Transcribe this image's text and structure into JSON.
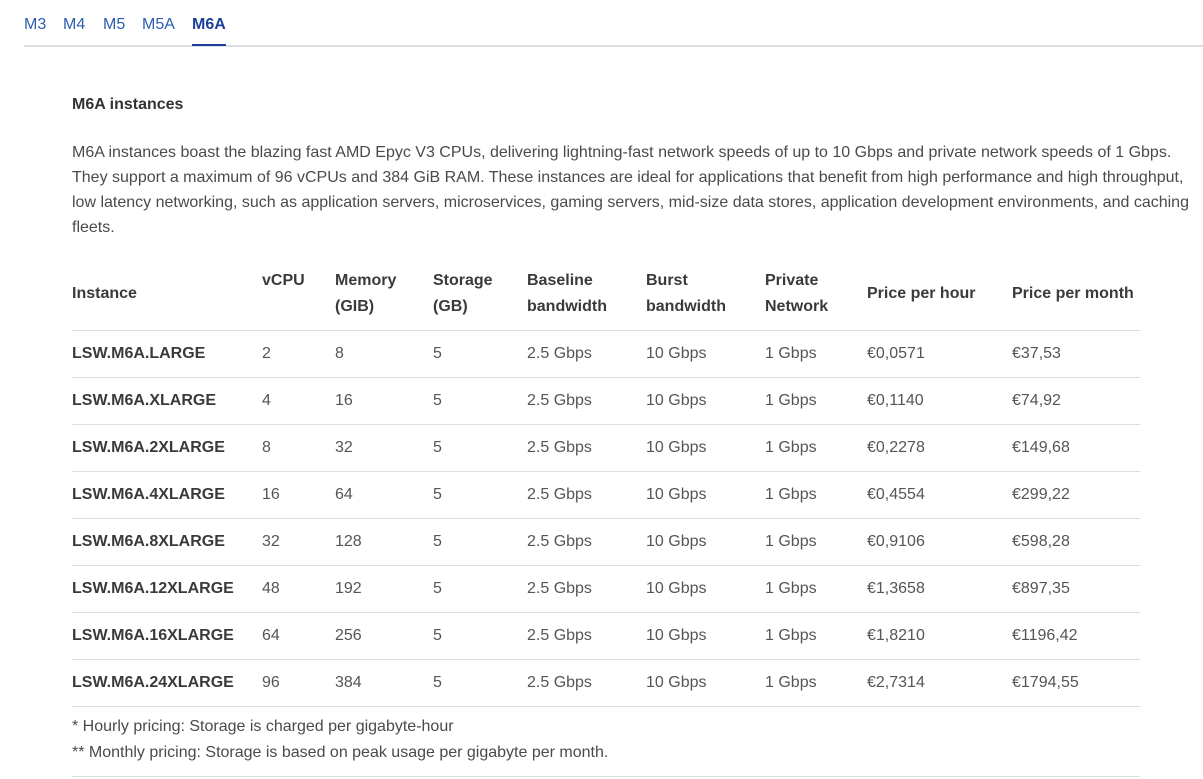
{
  "tabs": [
    {
      "label": "M3",
      "active": false
    },
    {
      "label": "M4",
      "active": false
    },
    {
      "label": "M5",
      "active": false
    },
    {
      "label": "M5A",
      "active": false
    },
    {
      "label": "M6A",
      "active": true
    }
  ],
  "section": {
    "title": "M6A instances",
    "description": "M6A instances boast the blazing fast AMD Epyc V3 CPUs, delivering lightning-fast network speeds of up to 10 Gbps and private network speeds of 1 Gbps. They support a maximum of 96 vCPUs and 384 GiB RAM. These instances are ideal for applications that benefit from high performance and high throughput, low latency networking, such as application servers, microservices, gaming servers, mid-size data stores, application development environments, and caching fleets."
  },
  "table": {
    "headers": [
      "Instance",
      "vCPU",
      "Memory (GIB)",
      "Storage (GB)",
      "Baseline bandwidth",
      "Burst bandwidth",
      "Private Network",
      "Price per hour",
      "Price per month"
    ],
    "rows": [
      [
        "LSW.M6A.LARGE",
        "2",
        "8",
        "5",
        "2.5 Gbps",
        "10 Gbps",
        "1 Gbps",
        "€0,0571",
        "€37,53"
      ],
      [
        "LSW.M6A.XLARGE",
        "4",
        "16",
        "5",
        "2.5 Gbps",
        "10 Gbps",
        "1 Gbps",
        "€0,1140",
        "€74,92"
      ],
      [
        "LSW.M6A.2XLARGE",
        "8",
        "32",
        "5",
        "2.5 Gbps",
        "10 Gbps",
        "1 Gbps",
        "€0,2278",
        "€149,68"
      ],
      [
        "LSW.M6A.4XLARGE",
        "16",
        "64",
        "5",
        "2.5 Gbps",
        "10 Gbps",
        "1 Gbps",
        "€0,4554",
        "€299,22"
      ],
      [
        "LSW.M6A.8XLARGE",
        "32",
        "128",
        "5",
        "2.5 Gbps",
        "10 Gbps",
        "1 Gbps",
        "€0,9106",
        "€598,28"
      ],
      [
        "LSW.M6A.12XLARGE",
        "48",
        "192",
        "5",
        "2.5 Gbps",
        "10 Gbps",
        "1 Gbps",
        "€1,3658",
        "€897,35"
      ],
      [
        "LSW.M6A.16XLARGE",
        "64",
        "256",
        "5",
        "2.5 Gbps",
        "10 Gbps",
        "1 Gbps",
        "€1,8210",
        "€1196,42"
      ],
      [
        "LSW.M6A.24XLARGE",
        "96",
        "384",
        "5",
        "2.5 Gbps",
        "10 Gbps",
        "1 Gbps",
        "€2,7314",
        "€1794,55"
      ]
    ]
  },
  "notes": [
    "* Hourly pricing: Storage is charged per gigabyte-hour",
    "** Monthly pricing: Storage is based on peak usage per gigabyte per month."
  ],
  "colors": {
    "tab_link": "#2a5db0",
    "tab_active": "#1b3f9b",
    "divider": "#dcdde1"
  }
}
